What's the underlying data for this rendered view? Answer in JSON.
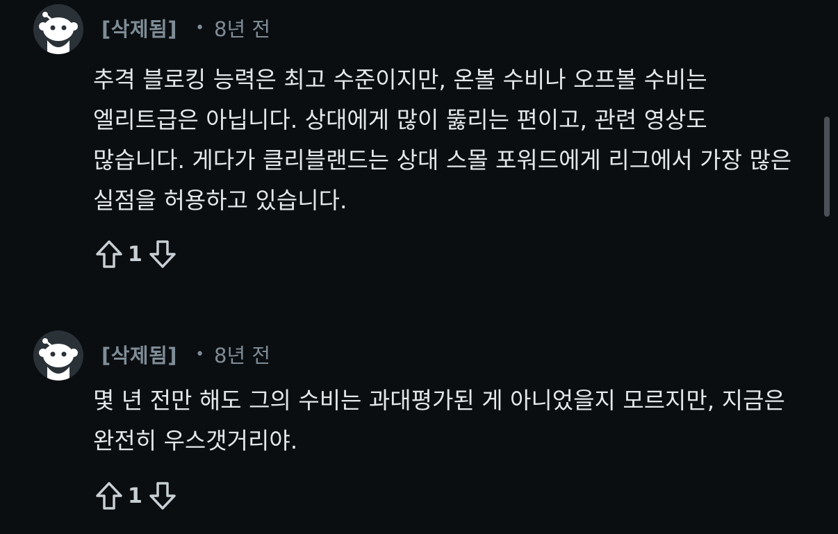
{
  "comments": [
    {
      "author": "[삭제됨]",
      "separator": "•",
      "time": "8년 전",
      "body": "추격 블로킹 능력은 최고 수준이지만, 온볼 수비나 오프볼 수비는 엘리트급은 아닙니다. 상대에게 많이 뚫리는 편이고, 관련 영상도 많습니다. 게다가 클리블랜드는 상대 스몰 포워드에게 리그에서 가장 많은 실점을 허용하고 있습니다.",
      "score": "1",
      "avatar_icon": "snoo-avatar-icon"
    },
    {
      "author": "[삭제됨]",
      "separator": "•",
      "time": "8년 전",
      "body": "몇 년 전만 해도 그의 수비는 과대평가된 게 아니었을지 모르지만, 지금은 완전히 우스갯거리야.",
      "score": "1",
      "avatar_icon": "snoo-avatar-icon"
    }
  ],
  "icons": {
    "upvote": "upvote-arrow-icon",
    "downvote": "downvote-arrow-icon"
  },
  "colors": {
    "background": "#0b0e11",
    "meta_text": "#7f8d97",
    "body_text": "#e4e8eb"
  }
}
